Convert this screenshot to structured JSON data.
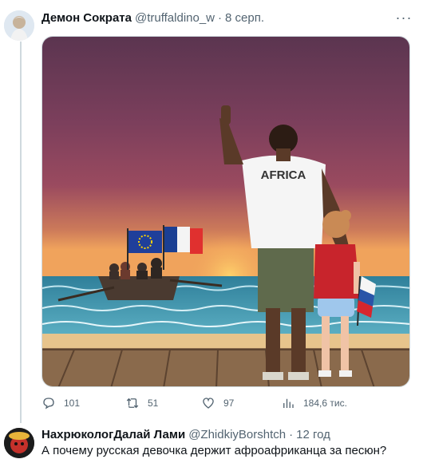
{
  "tweet": {
    "display_name": "Демон Сократа",
    "handle": "@truffaldino_w",
    "separator": "·",
    "time": "8 серп.",
    "more_label": "···",
    "image": {
      "shirt_text": "AFRICA"
    },
    "actions": {
      "replies": "101",
      "retweets": "51",
      "likes": "97",
      "views": "184,6 тис."
    }
  },
  "reply": {
    "display_name": "НахрюкологДалай Лами",
    "handle": "@ZhidkiyBorshtch",
    "separator": "·",
    "time": "12 год",
    "text": "А почему русская девочка держит афроафриканца за песюн?"
  },
  "colors": {
    "text_primary": "#0f1419",
    "text_secondary": "#536471",
    "border": "#cfd9de"
  },
  "icons": [
    "more-icon",
    "reply-icon",
    "retweet-icon",
    "like-icon",
    "views-icon"
  ]
}
